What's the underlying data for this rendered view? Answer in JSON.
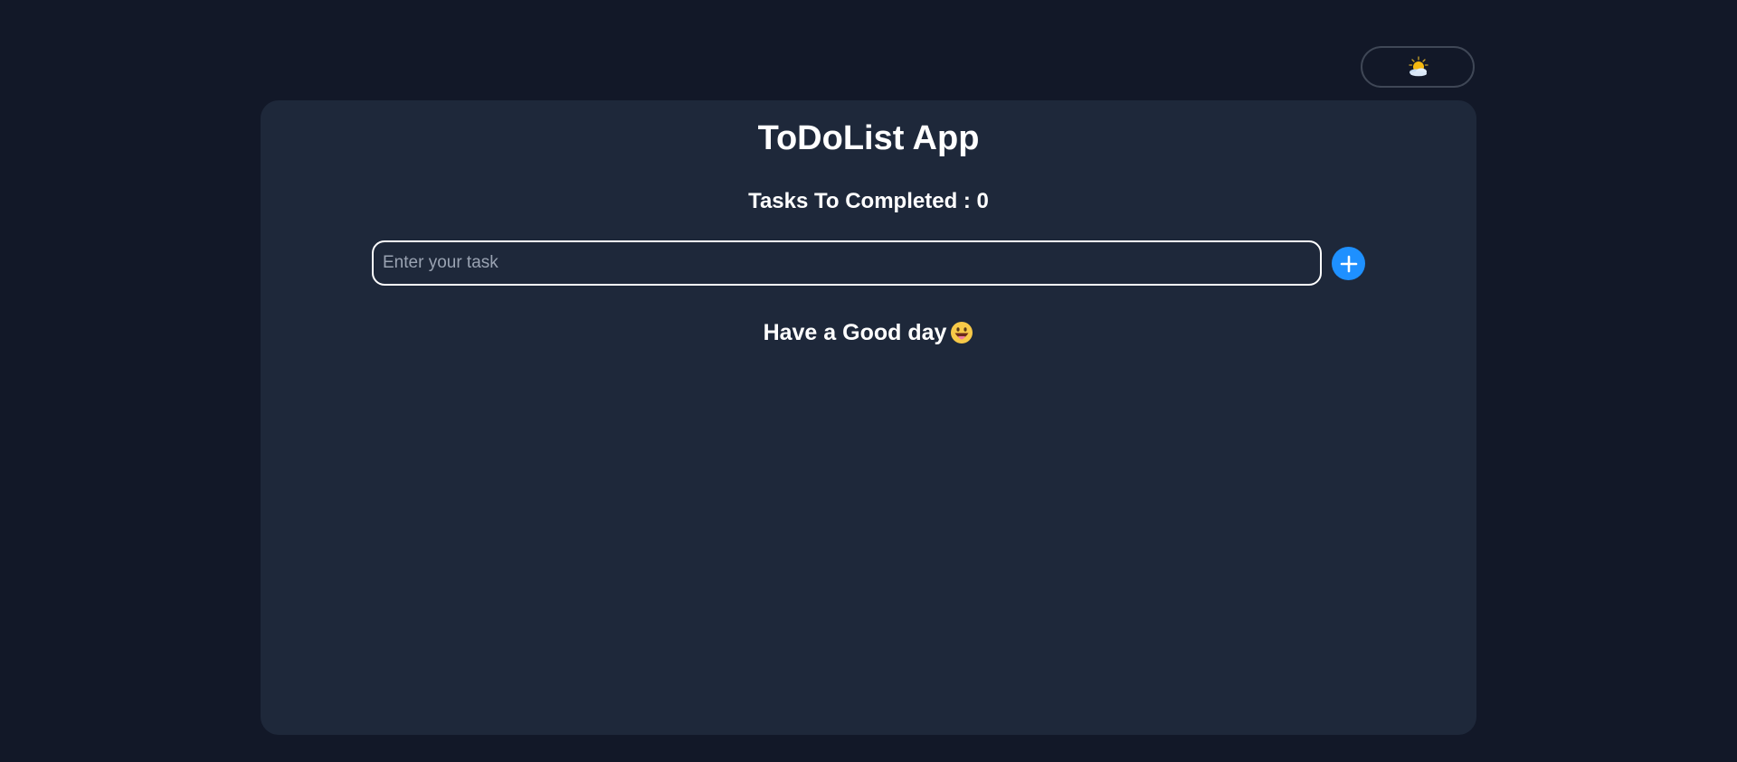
{
  "theme_toggle": {
    "icon": "sun-behind-cloud-icon"
  },
  "app": {
    "title": "ToDoList App",
    "counter_text": "Tasks To Completed : 0"
  },
  "task_input": {
    "value": "",
    "placeholder": "Enter your task"
  },
  "add_button": {
    "icon": "plus-icon"
  },
  "greeting": {
    "text": "Have a Good day",
    "emoji": "grinning-face-with-tongue-icon"
  },
  "colors": {
    "page_background": "#121828",
    "card_background": "#1e283a",
    "accent": "#1e90ff",
    "text": "#ffffff"
  }
}
